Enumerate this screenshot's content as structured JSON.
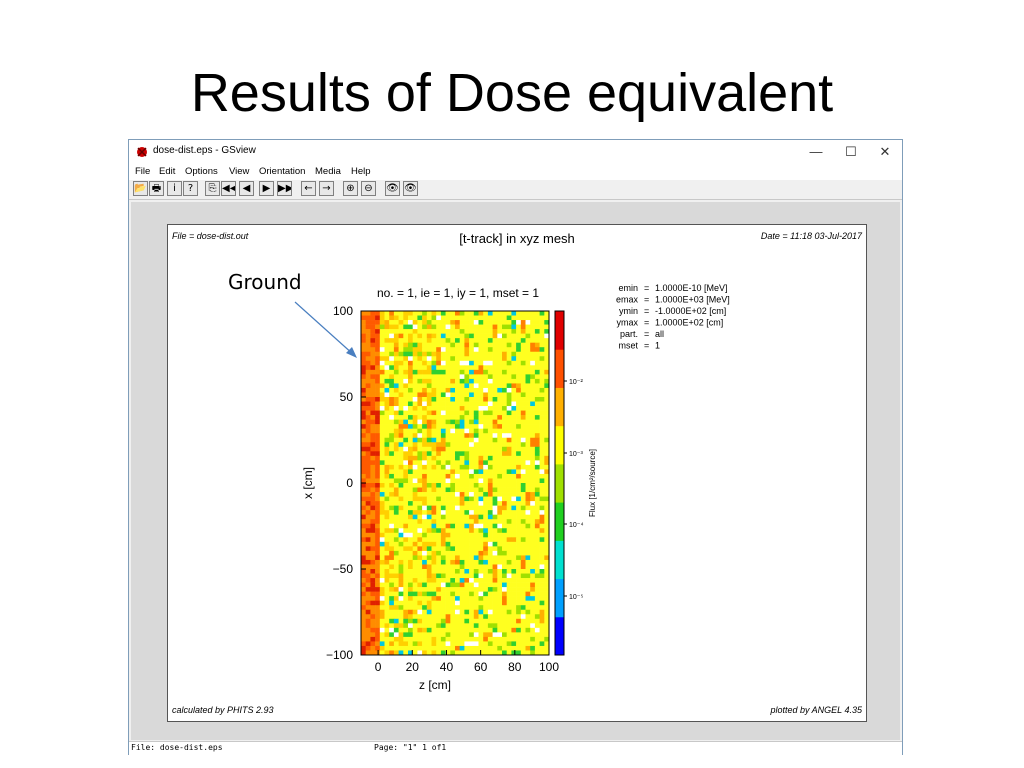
{
  "slide": {
    "title": "Results of Dose equivalent",
    "annotation": "Ground"
  },
  "window": {
    "title": "dose-dist.eps - GSview",
    "controls": {
      "minimize": "—",
      "maximize": "☐",
      "close": "✕"
    },
    "menu": [
      "File",
      "Edit",
      "Options",
      "View",
      "Orientation",
      "Media",
      "Help"
    ],
    "toolbar_icons": [
      "open-icon",
      "print-icon",
      "info-icon",
      "help-icon",
      "go-to-page-icon",
      "first-page-icon",
      "prev-page-icon",
      "next-page-icon",
      "last-page-icon",
      "back-icon",
      "forward-icon",
      "zoom-in-icon",
      "zoom-out-icon",
      "preview-icon",
      "show-all-icon"
    ],
    "toolbar_glyphs": [
      "📂",
      "🖶",
      "i",
      "?",
      "⎘",
      "◀◀",
      "◀",
      "▶",
      "▶▶",
      "←",
      "→",
      "⊕",
      "⊖",
      "👁",
      "👁"
    ],
    "status": {
      "file": "File: dose-dist.eps",
      "page": "Page: \"1\"  1 of1"
    }
  },
  "plot": {
    "file_label": "File = dose-dist.out",
    "title": "[t-track] in xyz mesh",
    "date_label": "Date = 11:18 03-Jul-2017",
    "subtitle": "no. =  1,  ie =  1,  iy =  1,  mset =  1",
    "params": [
      {
        "key": "emin",
        "value": "1.0000E-10 [MeV]"
      },
      {
        "key": "emax",
        "value": "1.0000E+03 [MeV]"
      },
      {
        "key": "ymin",
        "value": "-1.0000E+02 [cm]"
      },
      {
        "key": "ymax",
        "value": "1.0000E+02 [cm]"
      },
      {
        "key": "part.",
        "value": "all"
      },
      {
        "key": "mset",
        "value": "1"
      }
    ],
    "calc_label": "calculated by PHITS 2.93",
    "plot_label": "plotted by ANGEL 4.35"
  },
  "chart_data": {
    "type": "heatmap",
    "xlabel": "z [cm]",
    "ylabel": "x [cm]",
    "xlim": [
      -10,
      100
    ],
    "ylim": [
      -100,
      100
    ],
    "xticks": [
      "0",
      "20",
      "40",
      "60",
      "80",
      "100"
    ],
    "yticks": [
      "100",
      "50",
      "0",
      "−50",
      "−100"
    ],
    "colorbar": {
      "label": "Flux [1/cm²/source]",
      "scale": "log",
      "ticks": [
        "10⁻²",
        "10⁻³",
        "10⁻⁴",
        "10⁻⁵"
      ],
      "colors": [
        "#0000ff",
        "#00a0ff",
        "#00e0d0",
        "#20d020",
        "#a0e000",
        "#ffff00",
        "#ffb000",
        "#ff5000",
        "#e00000"
      ]
    },
    "background_level": "mostly yellow (~1e-2.5) with orange-red track streaks concentrated near z = -10 to 10"
  }
}
